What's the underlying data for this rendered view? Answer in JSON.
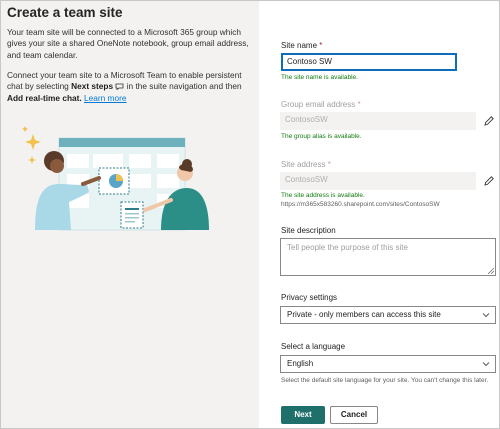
{
  "left": {
    "title": "Create a team site",
    "intro": "Your team site will be connected to a Microsoft 365 group which gives your site a shared OneNote notebook, group email address, and team calendar.",
    "intro2_a": "Connect your team site to a Microsoft Team to enable persistent chat by selecting ",
    "intro2_bold1": "Next steps",
    "intro2_b": " in the suite navigation and then ",
    "intro2_bold2": "Add real-time chat.",
    "learn_more": "Learn more"
  },
  "form": {
    "site_name_label": "Site name",
    "site_name_value": "Contoso SW",
    "site_name_status": "The site name is available.",
    "group_email_label": "Group email address",
    "group_email_value": "ContosoSW",
    "group_email_status": "The group alias is available.",
    "site_address_label": "Site address",
    "site_address_value": "ContosoSW",
    "site_address_status": "The site address is available.",
    "site_address_url": "https://m365x583260.sharepoint.com/sites/ContosoSW",
    "description_label": "Site description",
    "description_placeholder": "Tell people the purpose of this site",
    "privacy_label": "Privacy settings",
    "privacy_value": "Private - only members can access this site",
    "language_label": "Select a language",
    "language_value": "English",
    "language_hint": "Select the default site language for your site. You can't change this later.",
    "required_mark": "*"
  },
  "buttons": {
    "next": "Next",
    "cancel": "Cancel"
  },
  "colors": {
    "accent": "#1f6f6a",
    "success": "#107c10",
    "link": "#0078d4",
    "focus_border": "#0f6cbd"
  },
  "icons": {
    "edit": "pencil-icon",
    "dropdown": "chevron-down-icon",
    "chat": "chat-icon"
  }
}
